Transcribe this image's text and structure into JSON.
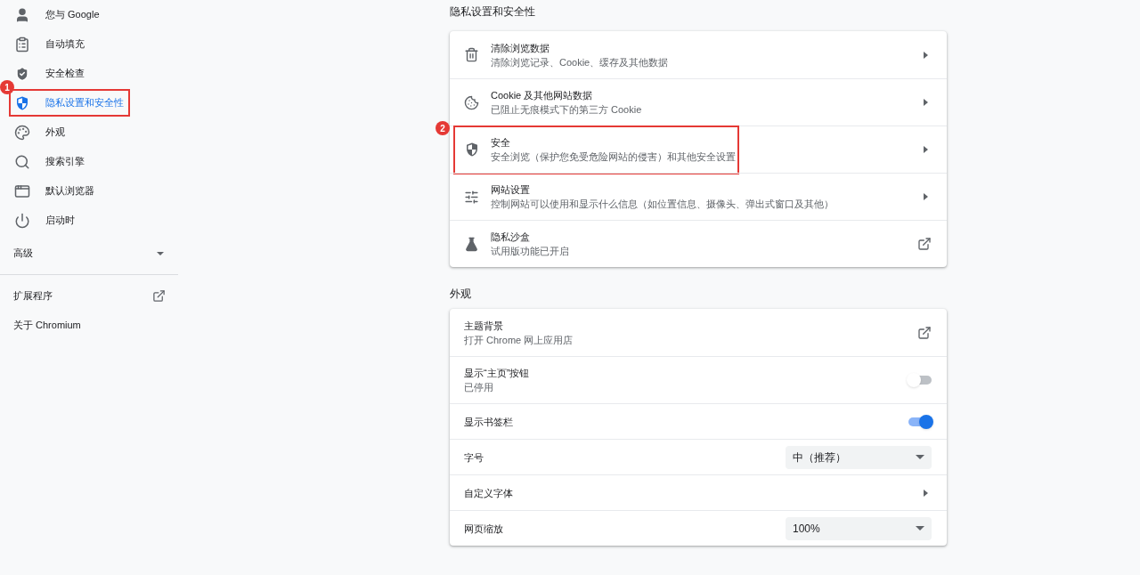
{
  "sidebar": {
    "items": [
      {
        "label": "您与 Google",
        "selected": false
      },
      {
        "label": "自动填充",
        "selected": false
      },
      {
        "label": "安全检查",
        "selected": false
      },
      {
        "label": "隐私设置和安全性",
        "selected": true,
        "annotation": "1"
      },
      {
        "label": "外观",
        "selected": false
      },
      {
        "label": "搜索引擎",
        "selected": false
      },
      {
        "label": "默认浏览器",
        "selected": false
      },
      {
        "label": "启动时",
        "selected": false
      }
    ],
    "advanced": {
      "label": "高级",
      "expanded": false
    },
    "links": [
      {
        "label": "扩展程序",
        "kind": "external"
      },
      {
        "label": "关于 Chromium",
        "kind": "plain"
      }
    ]
  },
  "sections": [
    {
      "title": "隐私设置和安全性",
      "rows": [
        {
          "kind": "link",
          "title": "清除浏览数据",
          "subtitle": "清除浏览记录、Cookie、缓存及其他数据"
        },
        {
          "kind": "link",
          "title": "Cookie 及其他网站数据",
          "subtitle": "已阻止无痕模式下的第三方 Cookie"
        },
        {
          "kind": "link",
          "title": "安全",
          "subtitle": "安全浏览（保护您免受危险网站的侵害）和其他安全设置",
          "annotation": "2"
        },
        {
          "kind": "link",
          "title": "网站设置",
          "subtitle": "控制网站可以使用和显示什么信息（如位置信息、摄像头、弹出式窗口及其他）"
        },
        {
          "kind": "external",
          "title": "隐私沙盒",
          "subtitle": "试用版功能已开启"
        }
      ]
    },
    {
      "title": "外观",
      "rows": [
        {
          "kind": "external",
          "title": "主题背景",
          "subtitle": "打开 Chrome 网上应用店"
        },
        {
          "kind": "toggle",
          "title": "显示“主页”按钮",
          "subtitle": "已停用",
          "on": false
        },
        {
          "kind": "toggle",
          "title": "显示书签栏",
          "on": true
        },
        {
          "kind": "select",
          "title": "字号",
          "value": "中（推荐）"
        },
        {
          "kind": "link",
          "title": "自定义字体"
        },
        {
          "kind": "select",
          "title": "网页缩放",
          "value": "100%"
        }
      ]
    }
  ]
}
